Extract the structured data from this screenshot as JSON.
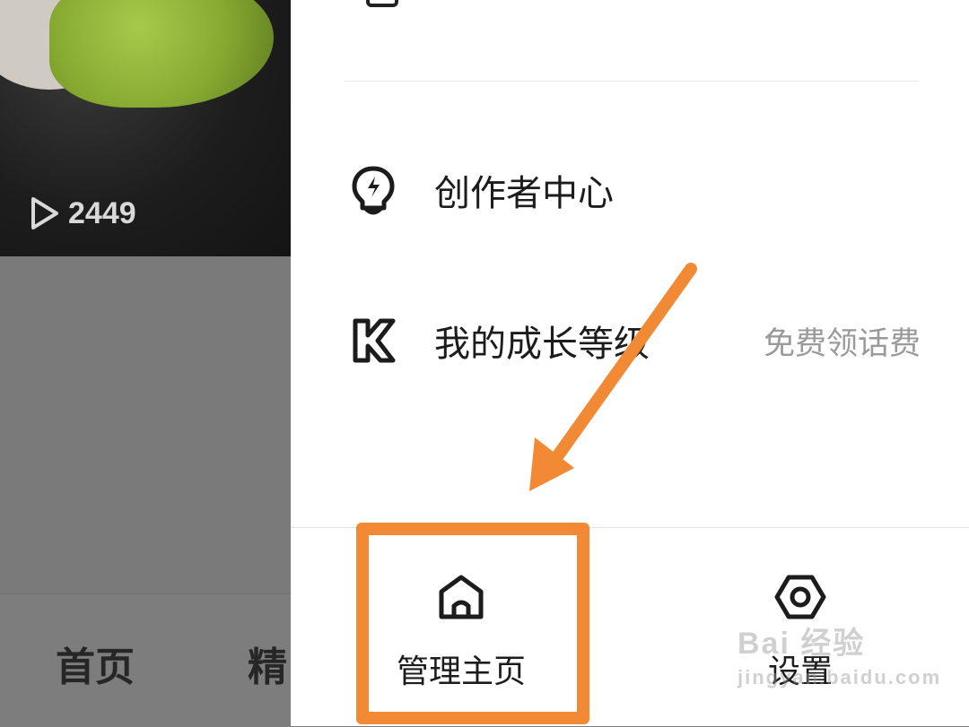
{
  "background_app": {
    "video_thumb": {
      "play_count": "2449",
      "play_icon": "play-icon"
    },
    "tabs": [
      "首页",
      "精"
    ]
  },
  "drawer": {
    "menu": [
      {
        "icon": "lightbulb-icon",
        "label": "创作者中心",
        "extra": ""
      },
      {
        "icon": "k-level-icon",
        "label": "我的成长等级",
        "extra": "免费领话费"
      }
    ],
    "bottom_actions": [
      {
        "icon": "home-icon",
        "label": "管理主页"
      },
      {
        "icon": "hex-settings-icon",
        "label": "设置"
      }
    ]
  },
  "annotation": {
    "color": "#f28a35"
  },
  "watermark": {
    "main": "Bai 经验",
    "sub": "jingyan.baidu.com"
  }
}
